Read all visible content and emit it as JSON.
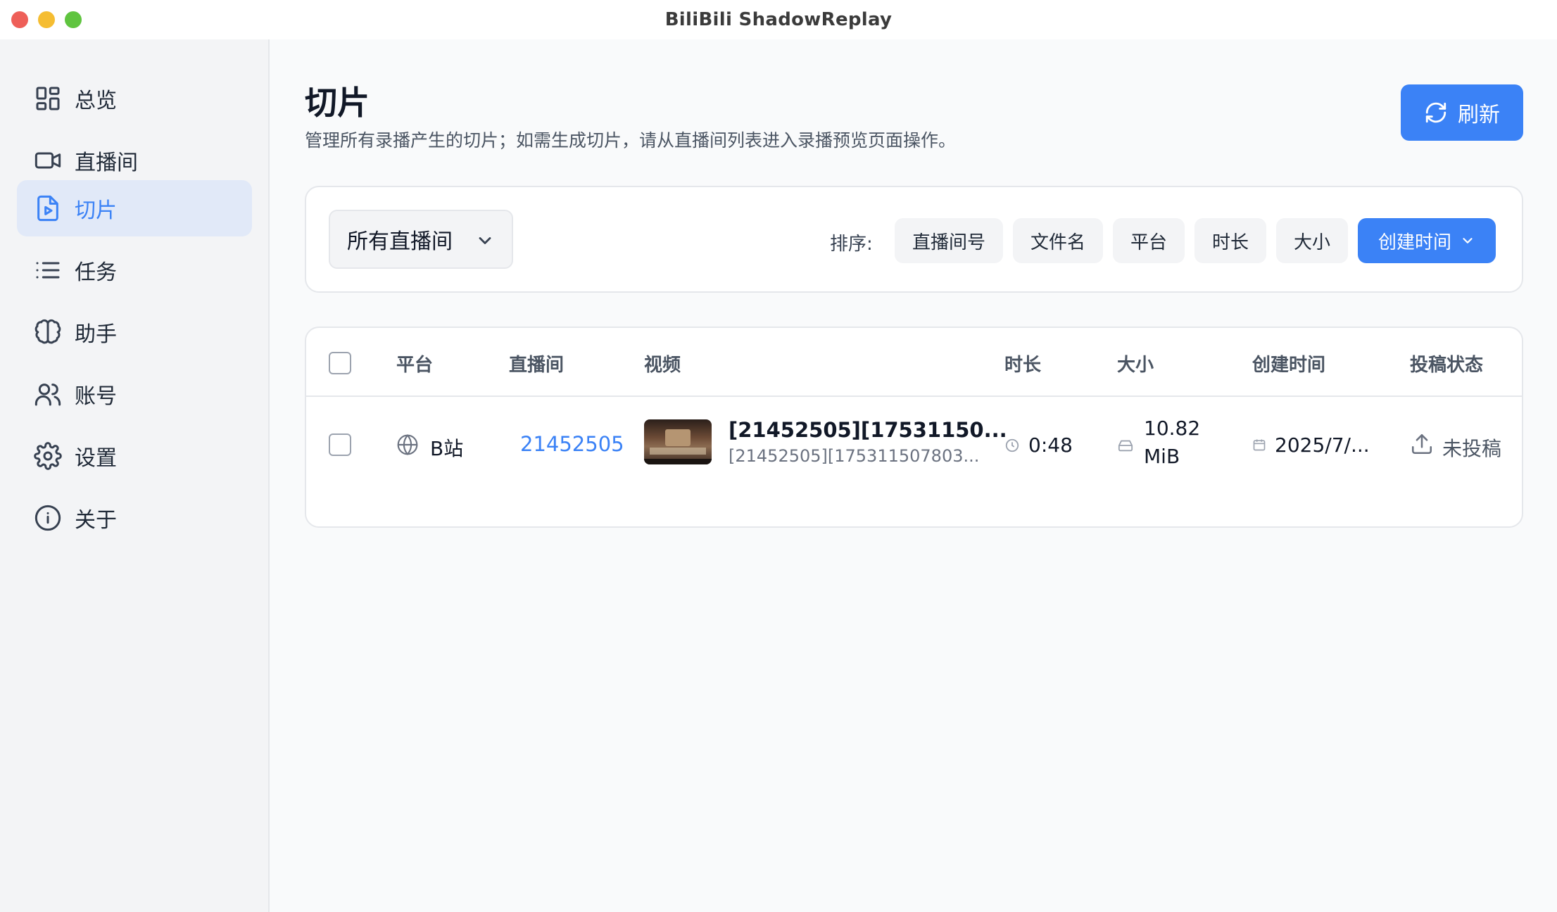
{
  "window": {
    "title": "BiliBili ShadowReplay"
  },
  "sidebar": {
    "items": [
      {
        "label": "总览",
        "icon": "dashboard-icon",
        "active": false
      },
      {
        "label": "直播间",
        "icon": "video-camera-icon",
        "active": false
      },
      {
        "label": "切片",
        "icon": "file-play-icon",
        "active": true
      },
      {
        "label": "任务",
        "icon": "list-icon",
        "active": false
      },
      {
        "label": "助手",
        "icon": "brain-icon",
        "active": false
      },
      {
        "label": "账号",
        "icon": "users-icon",
        "active": false
      },
      {
        "label": "设置",
        "icon": "gear-icon",
        "active": false
      },
      {
        "label": "关于",
        "icon": "info-icon",
        "active": false
      }
    ]
  },
  "header": {
    "title": "切片",
    "subtitle": "管理所有录播产生的切片；如需生成切片，请从直播间列表进入录播预览页面操作。",
    "refresh_label": "刷新"
  },
  "filters": {
    "room_select": "所有直播间",
    "sort_label": "排序:",
    "sort_options": [
      "直播间号",
      "文件名",
      "平台",
      "时长",
      "大小",
      "创建时间"
    ],
    "active_sort": "创建时间"
  },
  "table": {
    "columns": [
      "平台",
      "直播间",
      "视频",
      "时长",
      "大小",
      "创建时间",
      "投稿状态"
    ],
    "rows": [
      {
        "platform": "B站",
        "room": "21452505",
        "video_title": "[21452505][17531150...",
        "video_file": "[21452505][175311507803...",
        "duration": "0:48",
        "size_line1": "10.82",
        "size_line2": "MiB",
        "created": "2025/7/...",
        "status": "未投稿"
      }
    ]
  },
  "colors": {
    "accent": "#3b82f6",
    "active_bg": "#e1e9f8"
  }
}
